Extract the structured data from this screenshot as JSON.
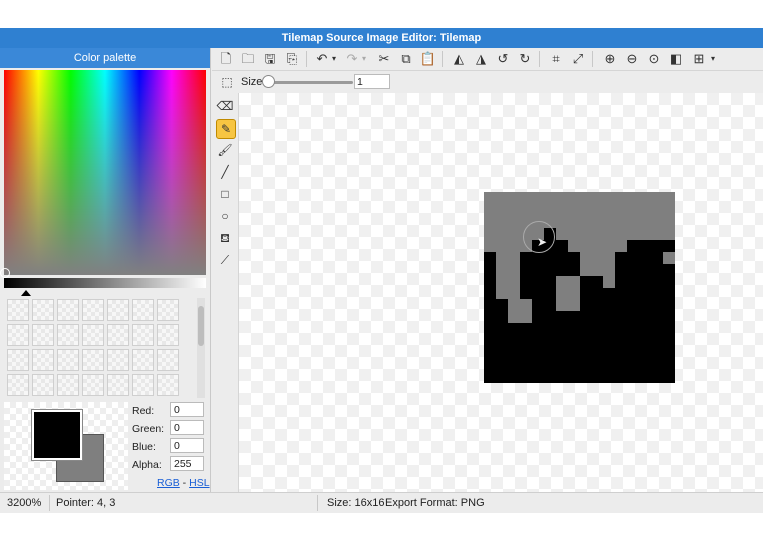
{
  "window": {
    "title": "Tilemap Source Image Editor: Tilemap"
  },
  "palette": {
    "title": "Color palette",
    "fields": [
      {
        "label": "Red:",
        "value": "0"
      },
      {
        "label": "Green:",
        "value": "0"
      },
      {
        "label": "Blue:",
        "value": "0"
      },
      {
        "label": "Alpha:",
        "value": "255"
      }
    ],
    "mode_rgb": "RGB",
    "mode_separator": " - ",
    "mode_hsl": "HSL",
    "foreground_color": "#000000",
    "background_color": "#7f7f7f"
  },
  "toolbar": {
    "icons": [
      "new-file-icon",
      "open-folder-icon",
      "save-icon",
      "save-as-icon",
      "undo-icon",
      "redo-icon",
      "cut-icon",
      "copy-icon",
      "paste-icon",
      "flip-horizontal-icon",
      "flip-vertical-icon",
      "rotate-ccw-icon",
      "rotate-cw-icon",
      "crop-icon",
      "resize-icon",
      "zoom-in-icon",
      "zoom-out-icon",
      "zoom-fit-icon",
      "contrast-icon",
      "grid-icon"
    ]
  },
  "size_bar": {
    "label": "Size",
    "value": "1",
    "level": 0
  },
  "tools": {
    "items": [
      "select-icon",
      "eraser-icon",
      "pencil-icon",
      "brush-icon",
      "line-icon",
      "rectangle-icon",
      "ellipse-icon",
      "fill-icon",
      "eyedropper-icon"
    ],
    "active": "pencil-icon",
    "accent": "#f7c542"
  },
  "tile": {
    "width": 16,
    "height": 16,
    "gray": "#7f7f7f",
    "black": "#000000",
    "gray_rows": [
      "1111111111111111",
      "1111111111111111",
      "1111111111111111",
      "1111101111111111",
      "1111000111110000",
      "0110000011100001",
      "0110000011100000",
      "0110001100100000",
      "0110001100000000",
      "0011001100000000",
      "0011000000000000",
      "0000000000000000",
      "0000000000000000",
      "0000000000000000",
      "0000000000000000",
      "0000000000000000"
    ]
  },
  "status": {
    "zoom": "3200%",
    "pointer": "Pointer: 4, 3",
    "size": "Size: 16x16",
    "export": "Export Format: PNG"
  }
}
